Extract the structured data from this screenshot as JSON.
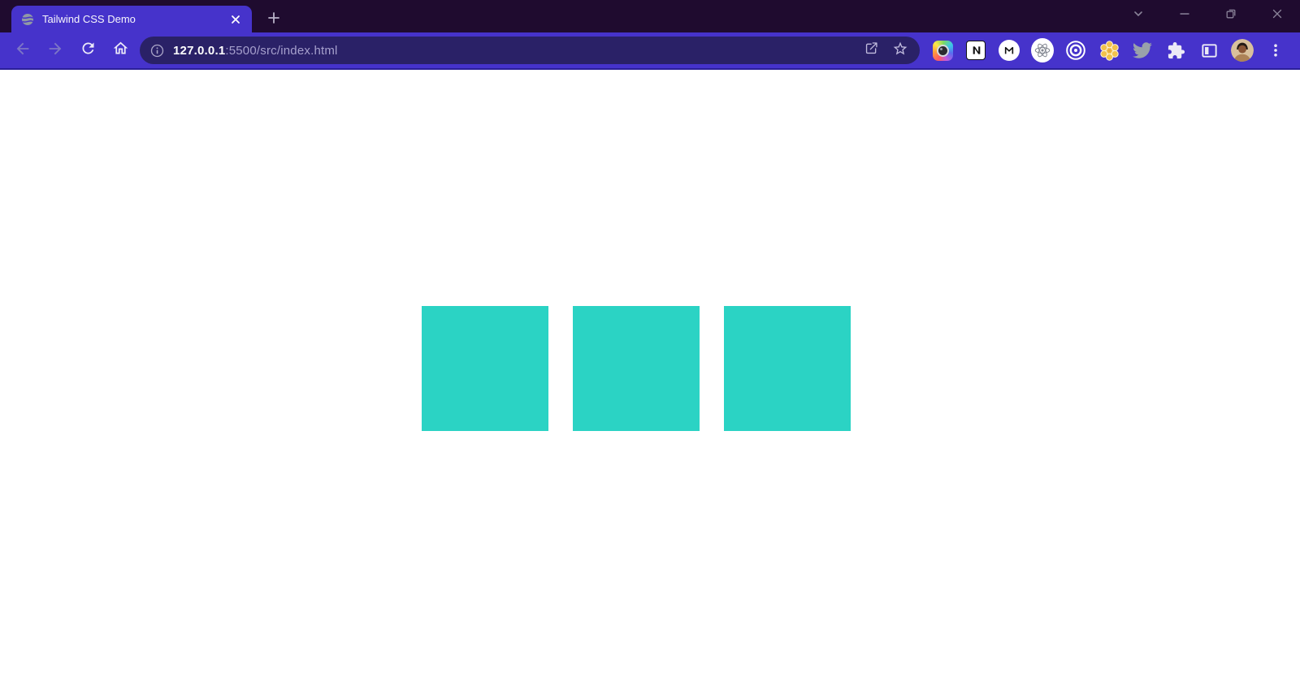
{
  "tabbar": {
    "tab": {
      "title": "Tailwind CSS Demo",
      "favicon": "globe-icon"
    },
    "new_tab_icon": "plus-icon",
    "window_controls": [
      {
        "name": "tab-search",
        "icon": "chevron-down-icon"
      },
      {
        "name": "minimize",
        "icon": "minimize-icon"
      },
      {
        "name": "restore",
        "icon": "restore-icon"
      },
      {
        "name": "close-window",
        "icon": "close-icon"
      }
    ]
  },
  "toolbar": {
    "nav": [
      {
        "name": "back",
        "icon": "arrow-left-icon",
        "enabled": false
      },
      {
        "name": "forward",
        "icon": "arrow-right-icon",
        "enabled": false
      },
      {
        "name": "reload",
        "icon": "reload-icon",
        "enabled": true
      },
      {
        "name": "home",
        "icon": "home-icon",
        "enabled": true
      }
    ],
    "omnibox": {
      "site_info_icon": "info-icon",
      "host": "127.0.0.1",
      "path": ":5500/src/index.html",
      "share_icon": "share-icon",
      "bookmark_icon": "star-icon"
    },
    "extensions": [
      "camera-lens-extension-icon",
      "notion-extension-icon",
      "mail-m-extension-icon",
      "react-devtools-extension-icon",
      "concentric-circles-extension-icon",
      "honeycomb-flower-extension-icon",
      "twitter-bird-extension-icon"
    ],
    "right_icons": [
      "extensions-puzzle-icon",
      "side-panel-icon",
      "profile-avatar",
      "more-menu-icon"
    ]
  },
  "content": {
    "squares": {
      "count": 3,
      "color": "#2bd3c4"
    }
  },
  "colors": {
    "frame_dark": "#1f0b2f",
    "frame_accent": "#4633cb",
    "omnibox_bg": "#2a2167",
    "toolbar_border": "#2b1f98",
    "page_bg": "#ffffff",
    "teal_square": "#2bd3c4"
  }
}
